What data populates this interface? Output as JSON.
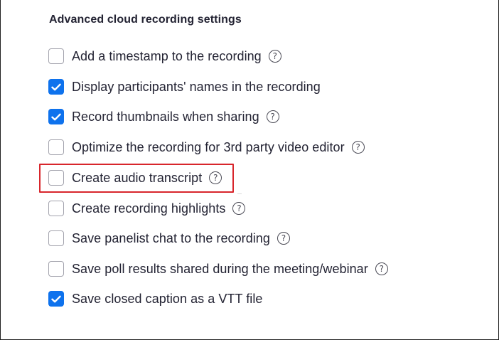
{
  "section": {
    "title": "Advanced cloud recording settings"
  },
  "options": [
    {
      "label": "Add a timestamp to the recording",
      "checked": false,
      "help": "?"
    },
    {
      "label": "Display participants' names in the recording",
      "checked": true
    },
    {
      "label": "Record thumbnails when sharing",
      "checked": true,
      "help": "?"
    },
    {
      "label": "Optimize the recording for 3rd party video editor",
      "checked": false,
      "help": "?"
    },
    {
      "label": "Create audio transcript",
      "checked": false,
      "help": "?"
    },
    {
      "label": "Create recording highlights",
      "checked": false,
      "help": "?"
    },
    {
      "label": "Save panelist chat to the recording",
      "checked": false,
      "help": "?"
    },
    {
      "label": "Save poll results shared during the meeting/webinar",
      "checked": false,
      "help": "?"
    },
    {
      "label": "Save closed caption as a VTT file",
      "checked": true
    }
  ],
  "colors": {
    "accent": "#0e72ed",
    "highlight": "#d8262c",
    "text": "#232333"
  },
  "icons": {
    "help": "question-circle-icon",
    "check": "checkmark-icon"
  }
}
